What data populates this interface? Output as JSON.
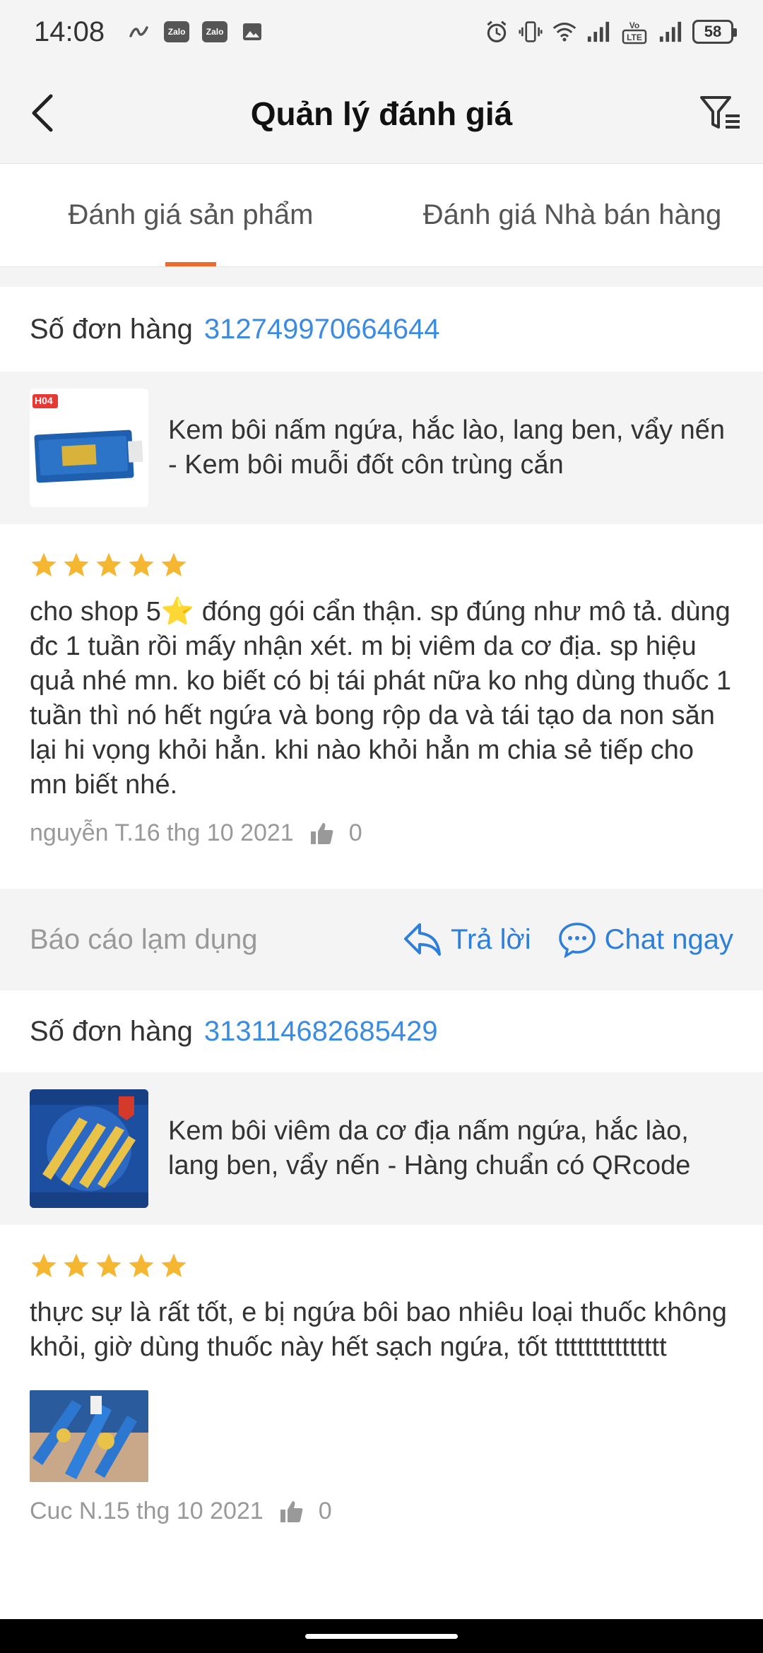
{
  "status_bar": {
    "time": "14:08",
    "left_icons": [
      "link-icon",
      "zalo-icon",
      "zalo-icon",
      "image-icon"
    ],
    "zalo_label": "Zalo",
    "right_icons": [
      "alarm-icon",
      "vibrate-icon",
      "wifi-icon",
      "signal-icon",
      "volte-icon",
      "signal-icon"
    ],
    "volte_label": "Vo LTE",
    "battery": "58"
  },
  "app_bar": {
    "title": "Quản lý đánh giá",
    "back_icon": "chevron-left-icon",
    "filter_icon": "filter-icon"
  },
  "tabs": [
    {
      "label": "Đánh giá sản phẩm",
      "active": true
    },
    {
      "label": "Đánh giá Nhà bán hàng",
      "active": false
    }
  ],
  "colors": {
    "accent": "#ee6a2f",
    "link": "#3b8be0",
    "star": "#f5b731",
    "background": "#f4f4f4"
  },
  "reviews": [
    {
      "order_label": "Số đơn hàng",
      "order_number": "312749970664644",
      "product_badge": "H04",
      "product_name": "Kem bôi nấm ngứa, hắc lào, lang ben, vẩy nến - Kem bôi muỗi đốt côn trùng cắn",
      "rating": 5,
      "text": "cho shop 5⭐ đóng gói cẩn thận. sp đúng như mô tả. dùng đc 1 tuần rồi mấy nhận xét. m bị viêm da cơ địa. sp hiệu quả nhé mn. ko biết có bị tái phát nữa ko nhg dùng thuốc 1 tuần thì nó hết ngứa và bong rộp da và tái tạo da non săn lại hi vọng khỏi hẳn. khi nào khỏi hẳn m chia sẻ tiếp cho mn biết nhé.",
      "author_date": "nguyễn T.16 thg 10 2021",
      "likes": "0"
    },
    {
      "order_label": "Số đơn hàng",
      "order_number": "313114682685429",
      "product_name": "Kem bôi viêm da cơ địa nấm ngứa, hắc lào, lang ben, vẩy nến - Hàng chuẩn có QRcode",
      "rating": 5,
      "text": "thực sự là rất tốt, e bị ngứa bôi bao nhiêu loại thuốc không khỏi, giờ dùng thuốc này hết sạch ngứa, tốt ttttttttttttttt",
      "author_date": "Cuc N.15 thg 10 2021",
      "likes": "0"
    }
  ],
  "actions": {
    "report": "Báo cáo lạm dụng",
    "reply": "Trả lời",
    "chat": "Chat ngay"
  }
}
